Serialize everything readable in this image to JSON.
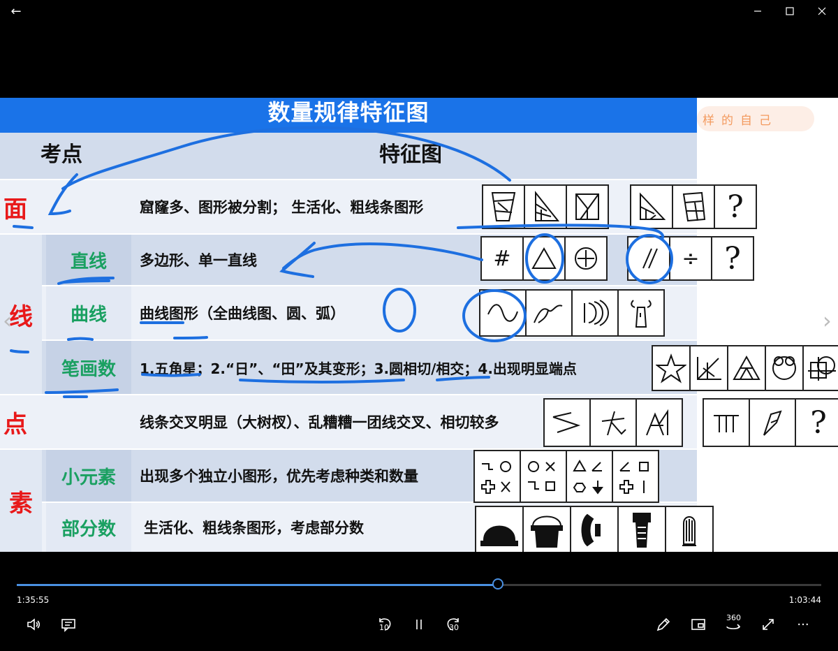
{
  "window": {
    "back_glyph": "←",
    "minimize_icon": "minimize-icon",
    "maximize_icon": "maximize-icon",
    "close_icon": "close-icon"
  },
  "slide": {
    "title": "数量规律特征图",
    "banner": "样的自己",
    "col_headers": {
      "point": "考点",
      "figure": "特征图"
    },
    "rows": {
      "mian": {
        "category": "面",
        "desc": "窟窿多、图形被分割； 生活化、粗线条图形"
      },
      "line_straight": {
        "category": "线",
        "sub": "直线",
        "desc": "多边形、单一直线",
        "symbols": [
          "#",
          "÷",
          "?"
        ]
      },
      "line_curve": {
        "sub": "曲线",
        "desc": "曲线图形（全曲线图、圆、弧）"
      },
      "line_stroke": {
        "sub": "笔画数",
        "desc": "1.五角星；2.“日”、“田”及其变形；3.圆相切/相交；4.出现明显端点"
      },
      "dian": {
        "category": "点",
        "desc": "线条交叉明显（大树杈）、乱糟糟一团线交叉、相切较多",
        "symbols": [
          "?"
        ]
      },
      "su_small": {
        "category": "素",
        "sub": "小元素",
        "desc": "出现多个独立小图形，优先考虑种类和数量"
      },
      "su_parts": {
        "sub": "部分数",
        "desc": "生活化、粗线条图形，考虑部分数"
      }
    },
    "mian_symbols": [
      "?"
    ]
  },
  "player": {
    "elapsed": "1:35:55",
    "remaining": "1:03:44",
    "progress": 0.598,
    "skip_back_label": "10",
    "skip_fwd_label": "30",
    "vr_label": "360",
    "more_glyph": "···",
    "accent": "#4a90e2"
  },
  "colors": {
    "header_blue": "#1a73e8",
    "category_red": "#e8191a",
    "sub_green": "#1aa061",
    "ink_blue": "#1d6fe0"
  }
}
